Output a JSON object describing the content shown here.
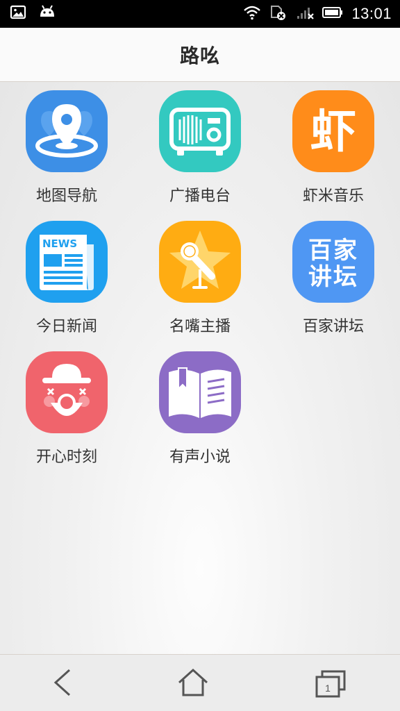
{
  "status_bar": {
    "time": "13:01",
    "icons": [
      "image-icon",
      "android-icon",
      "wifi-icon",
      "sim-disabled-icon",
      "signal-icon",
      "battery-icon"
    ]
  },
  "header": {
    "title": "路吆"
  },
  "apps": [
    {
      "label": "地图导航",
      "icon": "map-navigation-icon",
      "color": "#3d8fe6"
    },
    {
      "label": "广播电台",
      "icon": "radio-icon",
      "color": "#33c9c0"
    },
    {
      "label": "虾米音乐",
      "icon": "xiami-music-icon",
      "color": "#ff8c1a",
      "glyph": "虾"
    },
    {
      "label": "今日新闻",
      "icon": "news-icon",
      "color": "#1fa0ef",
      "glyph": "NEWS"
    },
    {
      "label": "名嘴主播",
      "icon": "microphone-star-icon",
      "color": "#ffac12"
    },
    {
      "label": "百家讲坛",
      "icon": "baijia-jiangtan-icon",
      "color": "#4f97f3",
      "glyph_line1": "百家",
      "glyph_line2": "讲坛"
    },
    {
      "label": "开心时刻",
      "icon": "clown-icon",
      "color": "#f0646c"
    },
    {
      "label": "有声小说",
      "icon": "audio-book-icon",
      "color": "#8c6cc6"
    }
  ],
  "navbar": {
    "items": [
      {
        "name": "back",
        "icon": "back-icon"
      },
      {
        "name": "home",
        "icon": "home-icon"
      },
      {
        "name": "recents",
        "icon": "recents-icon",
        "badge": "1"
      }
    ]
  }
}
